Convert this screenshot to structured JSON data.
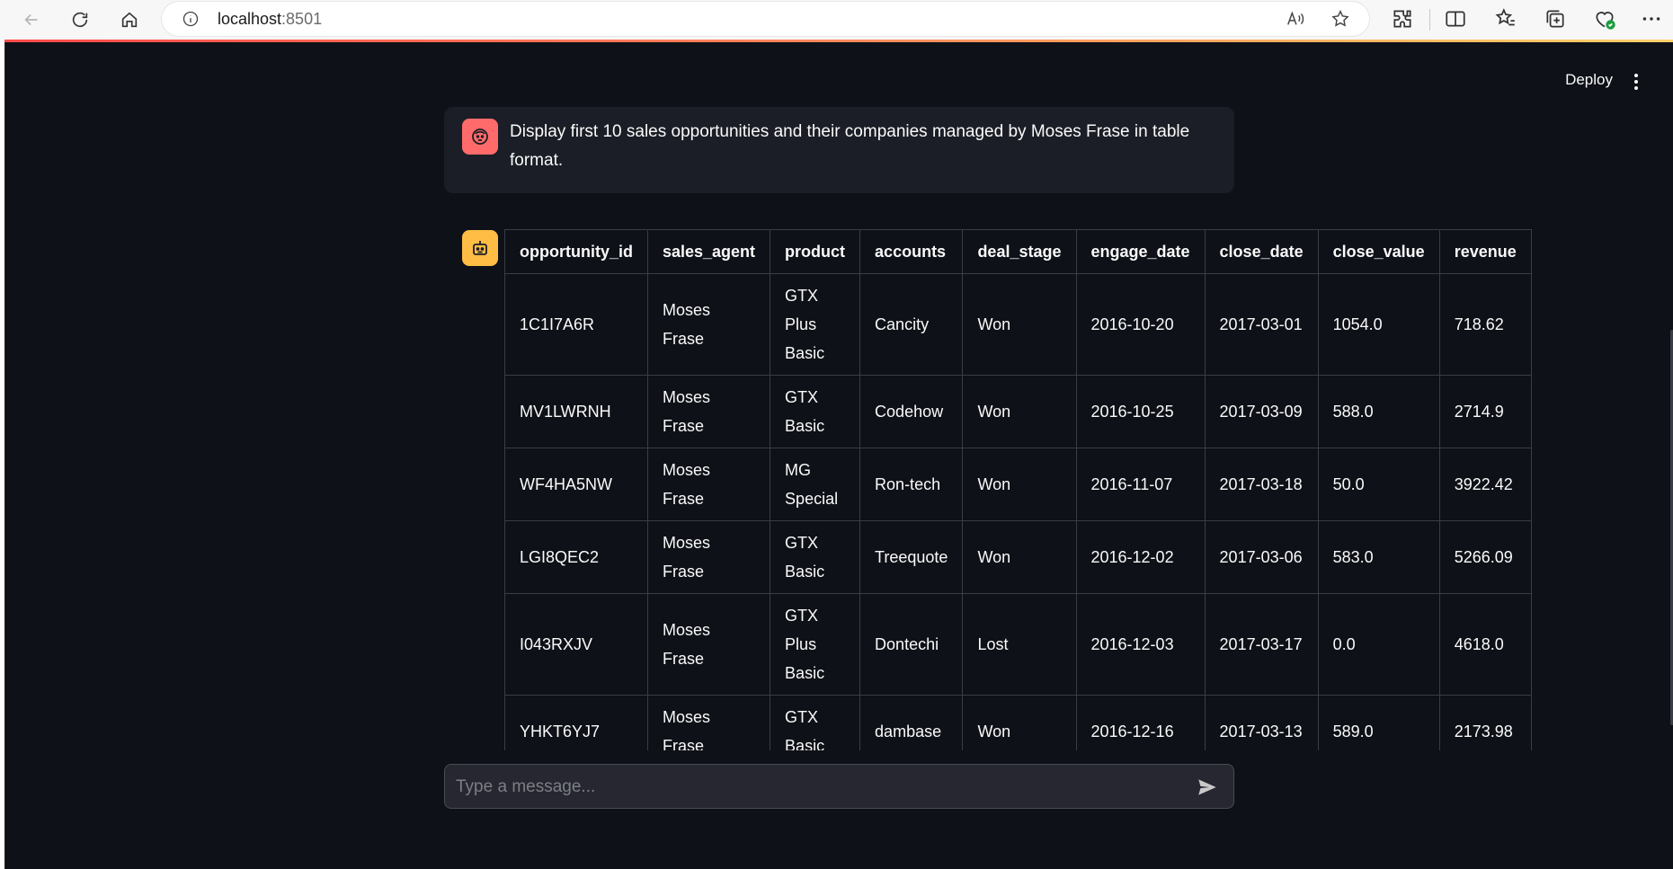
{
  "browser": {
    "url_host": "localhost",
    "url_port": ":8501"
  },
  "app": {
    "deploy_label": "Deploy"
  },
  "user_message": {
    "text": "Display first 10 sales opportunities and their companies managed by Moses Frase in table format."
  },
  "table": {
    "columns": [
      "opportunity_id",
      "sales_agent",
      "product",
      "accounts",
      "deal_stage",
      "engage_date",
      "close_date",
      "close_value",
      "revenue"
    ],
    "rows": [
      [
        "1C1I7A6R",
        "Moses Frase",
        "GTX Plus Basic",
        "Cancity",
        "Won",
        "2016-10-20",
        "2017-03-01",
        "1054.0",
        "718.62"
      ],
      [
        "MV1LWRNH",
        "Moses Frase",
        "GTX Basic",
        "Codehow",
        "Won",
        "2016-10-25",
        "2017-03-09",
        "588.0",
        "2714.9"
      ],
      [
        "WF4HA5NW",
        "Moses Frase",
        "MG Special",
        "Ron-tech",
        "Won",
        "2016-11-07",
        "2017-03-18",
        "50.0",
        "3922.42"
      ],
      [
        "LGI8QEC2",
        "Moses Frase",
        "GTX Basic",
        "Treequote",
        "Won",
        "2016-12-02",
        "2017-03-06",
        "583.0",
        "5266.09"
      ],
      [
        "I043RXJV",
        "Moses Frase",
        "GTX Plus Basic",
        "Dontechi",
        "Lost",
        "2016-12-03",
        "2017-03-17",
        "0.0",
        "4618.0"
      ],
      [
        "YHKT6YJ7",
        "Moses Frase",
        "GTX Basic",
        "dambase",
        "Won",
        "2016-12-16",
        "2017-03-13",
        "589.0",
        "2173.98"
      ]
    ]
  },
  "chat_input": {
    "placeholder": "Type a message..."
  },
  "colors": {
    "app_bg": "#0e1117",
    "user_avatar": "#ff6b6b",
    "bot_avatar": "#ffbd45",
    "accent": "#ff4b4b"
  }
}
